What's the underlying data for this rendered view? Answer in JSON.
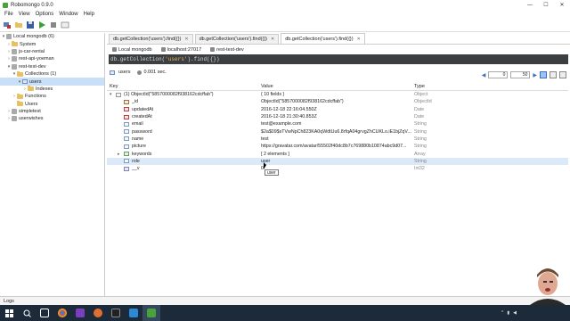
{
  "window": {
    "title": "Robomongo 0.9.0",
    "controls": [
      "—",
      "☐",
      "✕"
    ]
  },
  "menu": [
    "File",
    "View",
    "Options",
    "Window",
    "Help"
  ],
  "sidebar": {
    "items": [
      {
        "label": "Local mongodb (6)",
        "level": 0,
        "type": "server",
        "expanded": true
      },
      {
        "label": "System",
        "level": 1,
        "type": "folder",
        "expanded": false
      },
      {
        "label": "js-car-rental",
        "level": 1,
        "type": "db",
        "expanded": false
      },
      {
        "label": "rest-api-yoeman",
        "level": 1,
        "type": "db",
        "expanded": false
      },
      {
        "label": "rest-test-dev",
        "level": 1,
        "type": "db",
        "expanded": true
      },
      {
        "label": "Collections (1)",
        "level": 2,
        "type": "folder",
        "expanded": true
      },
      {
        "label": "users",
        "level": 3,
        "type": "collection",
        "selected": true
      },
      {
        "label": "Indexes",
        "level": 4,
        "type": "folder",
        "expanded": false
      },
      {
        "label": "Functions",
        "level": 2,
        "type": "folder",
        "expanded": false
      },
      {
        "label": "Users",
        "level": 2,
        "type": "folder",
        "expanded": false
      },
      {
        "label": "simpletest",
        "level": 1,
        "type": "db",
        "expanded": false
      },
      {
        "label": "userwishes",
        "level": 1,
        "type": "db",
        "expanded": false
      }
    ]
  },
  "tabs": [
    {
      "label": "db.getCollection('users').find({})",
      "active": false
    },
    {
      "label": "db.getCollection('users').find({})",
      "active": false
    },
    {
      "label": "db.getCollection('users').find({})",
      "active": true
    }
  ],
  "info": {
    "connection": "Local mongodb",
    "host": "localhost:27017",
    "database": "rest-test-dev"
  },
  "query": {
    "prefix": "db.getCollection(",
    "arg": "'users'",
    "suffix": ").find({})"
  },
  "results": {
    "collection": "users",
    "time": "0.001 sec.",
    "page_from": "0",
    "page_size": "50"
  },
  "grid": {
    "headers": [
      "Key",
      "Value",
      "Type"
    ],
    "rows": [
      {
        "key": "(1) ObjectId(\"5857000082f938162cdcffab\")",
        "value": "{ 10 fields }",
        "type": "Object",
        "icon": "obj",
        "indent": 0,
        "expander": "▾"
      },
      {
        "key": "_id",
        "value": "ObjectId(\"5857000082f938162cdcffab\")",
        "type": "ObjectId",
        "icon": "oid",
        "indent": 1,
        "expander": ""
      },
      {
        "key": "updatedAt",
        "value": "2016-12-18 22:16:04.550Z",
        "type": "Date",
        "icon": "date",
        "indent": 1,
        "expander": ""
      },
      {
        "key": "createdAt",
        "value": "2016-12-18 21:30:40.853Z",
        "type": "Date",
        "icon": "date",
        "indent": 1,
        "expander": ""
      },
      {
        "key": "email",
        "value": "test@example.com",
        "type": "String",
        "icon": "str",
        "indent": 1,
        "expander": ""
      },
      {
        "key": "password",
        "value": "$2a$09$sTVwNpCh823KA0qWdtUu6.8rfqA04grvgZhCUKLo.iE1bjZqV...",
        "type": "String",
        "icon": "str",
        "indent": 1,
        "expander": ""
      },
      {
        "key": "name",
        "value": "test",
        "type": "String",
        "icon": "str",
        "indent": 1,
        "expander": ""
      },
      {
        "key": "picture",
        "value": "https://gravatar.com/avatar/55502f40dc8b7c769880b10874abc9d07...",
        "type": "String",
        "icon": "str",
        "indent": 1,
        "expander": ""
      },
      {
        "key": "keywords",
        "value": "[ 2 elements ]",
        "type": "Array",
        "icon": "arr",
        "indent": 1,
        "expander": "▸"
      },
      {
        "key": "role",
        "value": "user",
        "type": "String",
        "icon": "str",
        "indent": 1,
        "expander": "",
        "highlight": true
      },
      {
        "key": "__v",
        "value": "0",
        "type": "Int32",
        "icon": "int",
        "indent": 1,
        "expander": ""
      }
    ]
  },
  "tooltip": "user",
  "logs_label": "Logs",
  "colors": {
    "query_bg": "#3c3f41",
    "selection": "#c9dff7",
    "taskbar": "#1c2a3a"
  }
}
